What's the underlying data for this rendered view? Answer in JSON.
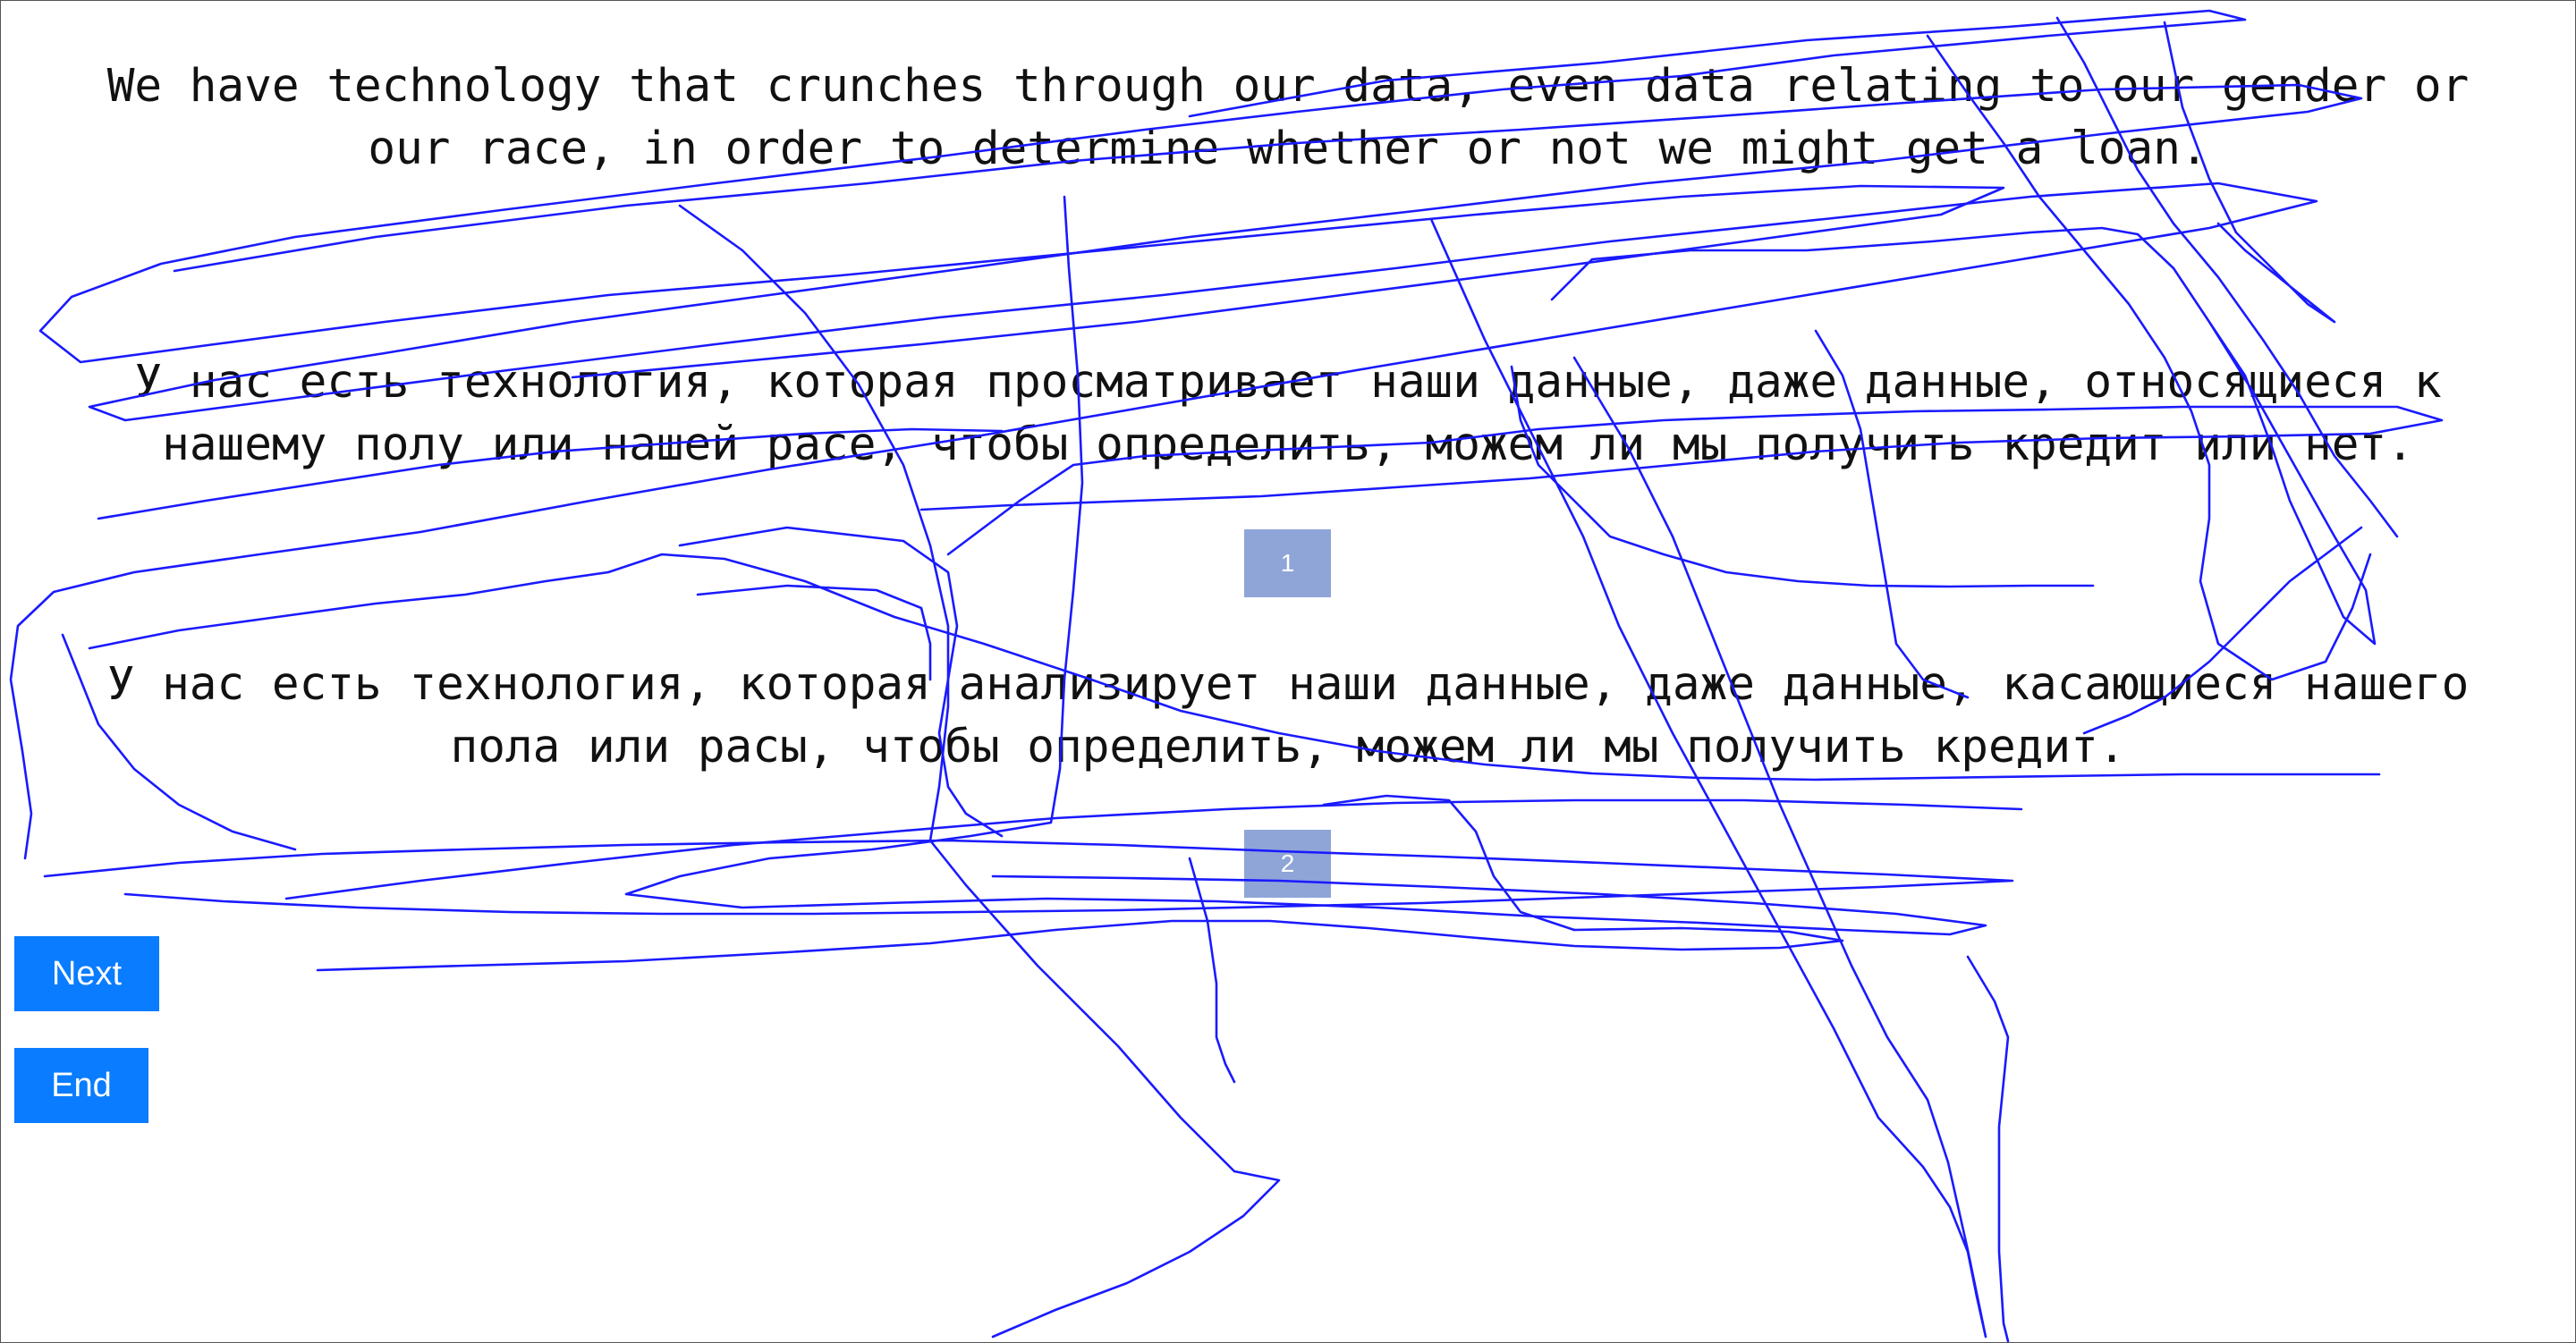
{
  "source": {
    "text": "We have technology that crunches through our data, even data relating to our gender or\nour race, in order to determine whether or not we might get a loan."
  },
  "translations": [
    {
      "text": "У нас есть технология, которая просматривает наши данные, даже данные, относящиеся к\nнашему полу или нашей расе, чтобы определить, можем ли мы получить кредит или нет.",
      "badge_label": "1"
    },
    {
      "text": "У нас есть технология, которая анализирует наши данные, даже данные, касающиеся нашего\nпола или расы, чтобы определить, можем ли мы получить кредит.",
      "badge_label": "2"
    }
  ],
  "buttons": {
    "next_label": "Next",
    "end_label": "End"
  },
  "colors": {
    "button": "#0a7cff",
    "badge": "#8fa5d8",
    "scribble": "#1a1aff"
  }
}
